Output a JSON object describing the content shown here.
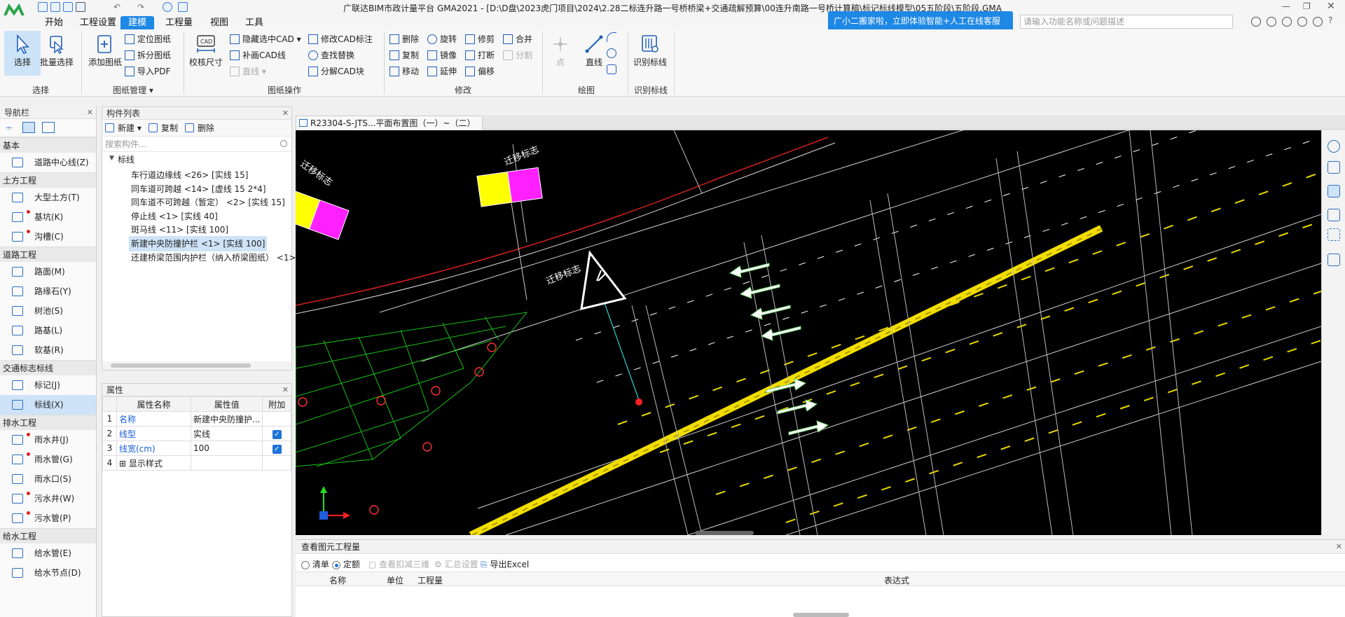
{
  "app": {
    "title": "广联达BIM市政计量平台 GMA2021 - [D:\\D盘\\2023虎门项目\\2024\\2.28二标连升路一号桥桥梁+交通疏解预算\\00连升南路一号桥计算稿\\标记标线模型\\05五阶段\\五阶段.GMA]"
  },
  "menu": {
    "items": [
      "开始",
      "工程设置",
      "建模",
      "工程量",
      "视图",
      "工具"
    ],
    "active_index": 2
  },
  "ribbon": {
    "select": {
      "select_label": "选择",
      "batch_label": "批量选择",
      "group": "选择"
    },
    "drawing": {
      "add_label": "添加图纸",
      "locate": "定位图纸",
      "split": "拆分图纸",
      "import_pdf": "导入PDF",
      "group": "图纸管理"
    },
    "cad": {
      "calibrate": "校核尺寸",
      "hide_cad": "隐藏选中CAD",
      "fill_cad": "补画CAD线",
      "line": "直线",
      "modify_cad": "修改CAD标注",
      "find_replace": "查找替换",
      "explode_block": "分解CAD块",
      "group": "图纸操作"
    },
    "modify": {
      "delete": "删除",
      "copy": "复制",
      "move": "移动",
      "rotate": "旋转",
      "mirror": "镜像",
      "extend": "延伸",
      "trim": "修剪",
      "break": "打断",
      "offset": "偏移",
      "merge": "合并",
      "split": "分割",
      "group": "修改"
    },
    "draw": {
      "point": "点",
      "line": "直线",
      "group": "绘图"
    },
    "recognize": {
      "label": "识别标线",
      "group": "识别标线"
    }
  },
  "banner": {
    "text": "广小二搬家啦，立即体验智能+人工在线客服"
  },
  "search": {
    "placeholder": "请输入功能名称或问题描述"
  },
  "nav": {
    "title": "导航栏",
    "categories": [
      {
        "name": "基本",
        "items": [
          {
            "label": "道路中心线(Z)",
            "dot": false
          }
        ]
      },
      {
        "name": "土方工程",
        "items": [
          {
            "label": "大型土方(T)",
            "dot": false
          },
          {
            "label": "基坑(K)",
            "dot": true
          },
          {
            "label": "沟槽(C)",
            "dot": true
          }
        ]
      },
      {
        "name": "道路工程",
        "items": [
          {
            "label": "路面(M)",
            "dot": false
          },
          {
            "label": "路缘石(Y)",
            "dot": false
          },
          {
            "label": "树池(S)",
            "dot": false
          },
          {
            "label": "路基(L)",
            "dot": false
          },
          {
            "label": "软基(R)",
            "dot": false
          }
        ]
      },
      {
        "name": "交通标志标线",
        "items": [
          {
            "label": "标记(J)",
            "dot": false
          },
          {
            "label": "标线(X)",
            "dot": false,
            "selected": true
          }
        ]
      },
      {
        "name": "排水工程",
        "items": [
          {
            "label": "雨水井(J)",
            "dot": true
          },
          {
            "label": "雨水管(G)",
            "dot": true
          },
          {
            "label": "雨水口(S)",
            "dot": false
          },
          {
            "label": "污水井(W)",
            "dot": true
          },
          {
            "label": "污水管(P)",
            "dot": true
          }
        ]
      },
      {
        "name": "给水工程",
        "items": [
          {
            "label": "给水管(E)",
            "dot": false
          },
          {
            "label": "给水节点(D)",
            "dot": false
          }
        ]
      }
    ]
  },
  "components": {
    "title": "构件列表",
    "new_label": "新建",
    "copy_label": "复制",
    "delete_label": "删除",
    "search_placeholder": "搜索构件...",
    "root": "标线",
    "items": [
      "车行道边缘线 <26> [实线 15]",
      "同车道可跨越 <14> [虚线 15 2*4]",
      "同车道不可跨越（暂定） <2> [实线 15]",
      "停止线 <1> [实线 40]",
      "斑马线 <11> [实线 100]",
      "新建中央防撞护栏 <1> [实线 100]",
      "还建桥梁范围内护栏（纳入桥梁图纸） <1>"
    ],
    "selected_index": 5
  },
  "properties": {
    "title": "属性",
    "headers": [
      "属性名称",
      "属性值",
      "附加"
    ],
    "rows": [
      {
        "no": "1",
        "name": "名称",
        "value": "新建中央防撞护...",
        "extra": false
      },
      {
        "no": "2",
        "name": "线型",
        "value": "实线",
        "extra": true
      },
      {
        "no": "3",
        "name": "线宽(cm)",
        "value": "100",
        "extra": true
      },
      {
        "no": "4",
        "name": "显示样式",
        "value": "",
        "extra": false
      }
    ]
  },
  "canvas": {
    "tab": "R23304-S-JTS...平面布置图（一）~（二）",
    "labels": {
      "sign1": "迁移标志",
      "sign2": "迁移标志",
      "sign3": "迁移标志"
    }
  },
  "quantity": {
    "title": "查看图元工程量",
    "opt_list": "清单",
    "opt_quota": "定额",
    "opt_quota_selected": true,
    "view3d": "查看扣减三维",
    "summary": "汇总设置",
    "export": "导出Excel",
    "columns": [
      "名称",
      "单位",
      "工程量",
      "表达式"
    ]
  },
  "colors": {
    "accent": "#1e88e5",
    "cad_bg": "#000000"
  }
}
